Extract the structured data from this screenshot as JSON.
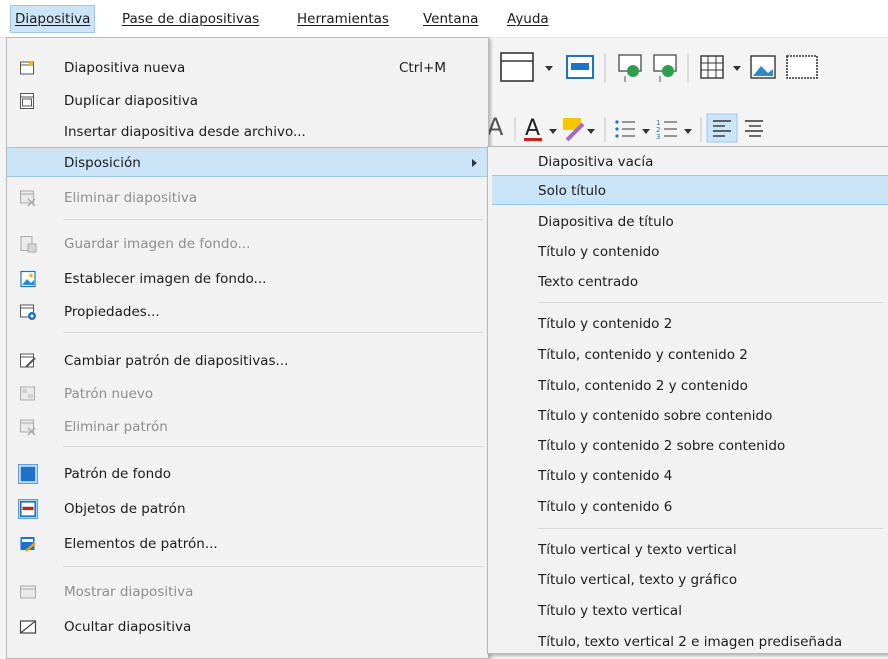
{
  "menubar": {
    "items": [
      {
        "label": "Diapositiva"
      },
      {
        "label": "Pase de diapositivas"
      },
      {
        "label": "Herramientas"
      },
      {
        "label": "Ventana"
      },
      {
        "label": "Ayuda"
      }
    ]
  },
  "menu": {
    "items": [
      {
        "label": "Diapositiva nueva",
        "shortcut": "Ctrl+M",
        "icon": "new-slide-icon"
      },
      {
        "label": "Duplicar diapositiva",
        "icon": "duplicate-slide-icon"
      },
      {
        "label": "Insertar diapositiva desde archivo..."
      },
      {
        "label": "Disposición"
      },
      {
        "label": "Eliminar diapositiva",
        "icon": "delete-slide-icon",
        "disabled": true
      },
      {
        "label": "Guardar imagen de fondo...",
        "icon": "save-background-icon",
        "disabled": true
      },
      {
        "label": "Establecer imagen de fondo...",
        "icon": "set-background-image-icon"
      },
      {
        "label": "Propiedades...",
        "icon": "properties-icon"
      },
      {
        "label": "Cambiar patrón de diapositivas...",
        "icon": "change-master-icon"
      },
      {
        "label": "Patrón nuevo",
        "icon": "new-master-icon",
        "disabled": true
      },
      {
        "label": "Eliminar patrón",
        "icon": "delete-master-icon",
        "disabled": true
      },
      {
        "label": "Patrón de fondo",
        "icon": "master-background-icon"
      },
      {
        "label": "Objetos de patrón",
        "icon": "master-objects-icon"
      },
      {
        "label": "Elementos de patrón...",
        "icon": "master-elements-icon"
      },
      {
        "label": "Mostrar diapositiva",
        "icon": "show-slide-icon",
        "disabled": true
      },
      {
        "label": "Ocultar diapositiva",
        "icon": "hide-slide-icon"
      }
    ]
  },
  "submenu": {
    "items": [
      {
        "label": "Diapositiva vacía"
      },
      {
        "label": "Solo título"
      },
      {
        "label": "Diapositiva de título"
      },
      {
        "label": "Título y contenido"
      },
      {
        "label": "Texto centrado"
      },
      {
        "label": "Título y contenido 2"
      },
      {
        "label": "Título, contenido y contenido 2"
      },
      {
        "label": "Título, contenido 2 y contenido"
      },
      {
        "label": "Título y contenido sobre contenido"
      },
      {
        "label": "Título y contenido 2 sobre contenido"
      },
      {
        "label": "Título y contenido 4"
      },
      {
        "label": "Título y contenido 6"
      },
      {
        "label": "Título vertical y texto vertical"
      },
      {
        "label": "Título vertical, texto y gráfico"
      },
      {
        "label": "Título y texto vertical"
      },
      {
        "label": "Título, texto vertical 2 e imagen prediseñada"
      }
    ]
  },
  "colors": {
    "highlight": "#cce4f7",
    "highlight_border": "#99c9ef",
    "accent_blue": "#1e73c8"
  }
}
